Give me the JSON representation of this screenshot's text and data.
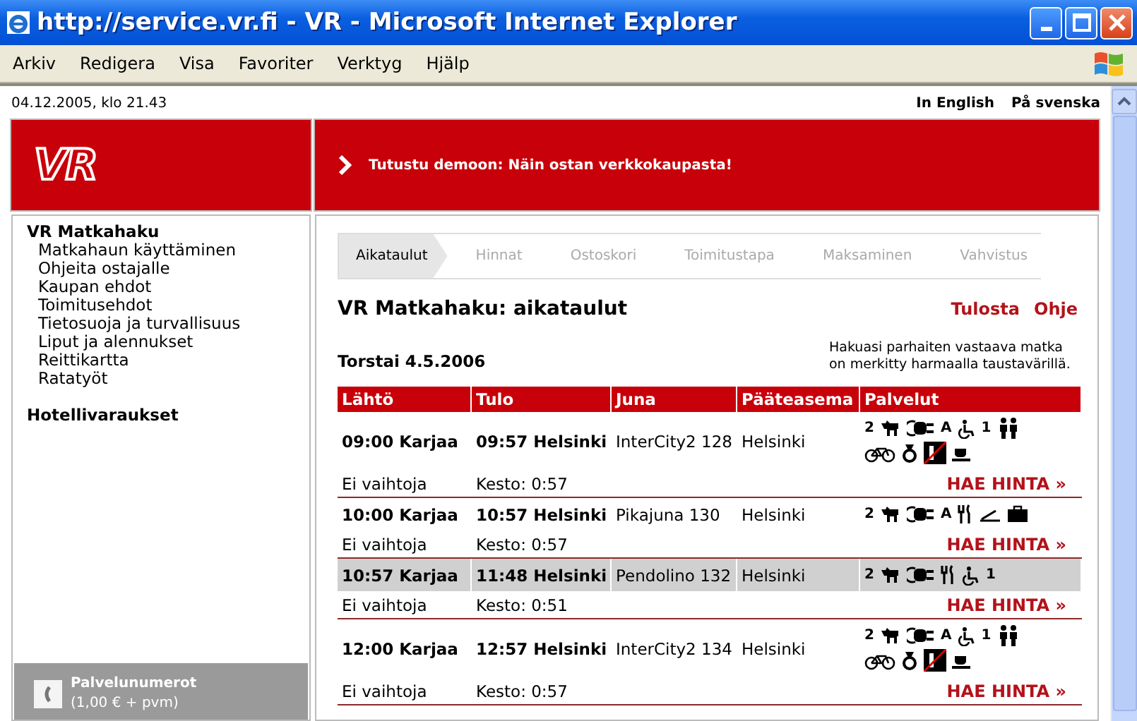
{
  "window": {
    "title": "http://service.vr.fi - VR - Microsoft Internet Explorer"
  },
  "menu": [
    "Arkiv",
    "Redigera",
    "Visa",
    "Favoriter",
    "Verktyg",
    "Hjälp"
  ],
  "page": {
    "date": "04.12.2005, klo 21.43",
    "languages": [
      "In English",
      "På svenska"
    ],
    "logo": "VR",
    "banner": "Tutustu demoon: Näin ostan verkkokaupasta!",
    "sidebar": {
      "sections": [
        {
          "title": "VR Matkahaku",
          "items": [
            "Matkahaun käyttäminen",
            "Ohjeita ostajalle",
            "Kaupan ehdot",
            "Toimitusehdot",
            "Tietosuoja ja turvallisuus",
            "Liput ja alennukset",
            "Reittikartta",
            "Ratatyöt"
          ]
        },
        {
          "title": "Hotellivaraukset"
        }
      ],
      "footer": {
        "title": "Palvelunumerot",
        "subtitle": "(1,00 € + pvm)"
      }
    },
    "steps": [
      {
        "label": "Aikataulut",
        "selected": true
      },
      {
        "label": "Hinnat",
        "selected": false
      },
      {
        "label": "Ostoskori",
        "selected": false
      },
      {
        "label": "Toimitustapa",
        "selected": false
      },
      {
        "label": "Maksaminen",
        "selected": false
      },
      {
        "label": "Vahvistus",
        "selected": false
      }
    ],
    "heading": "VR Matkahaku: aikataulut",
    "actions": [
      "Tulosta",
      "Ohje"
    ],
    "day": "Torstai 4.5.2006",
    "note": "Hakuasi parhaiten vastaava matka on merkitty harmaalla taustavärillä.",
    "table": {
      "columns": [
        "Lähtö",
        "Tulo",
        "Juna",
        "Pääteasema",
        "Palvelut"
      ],
      "rows": [
        {
          "departure": "09:00 Karjaa",
          "arrival": "09:57 Helsinki",
          "train": "InterCity2 128",
          "terminus": "Helsinki",
          "selected": false,
          "transfers": "Ei vaihtoja",
          "duration": "Kesto: 0:57",
          "price": "HAE HINTA »",
          "services": [
            [
              {
                "kind": "text",
                "text": "2"
              },
              {
                "kind": "dog"
              },
              {
                "kind": "plug"
              },
              {
                "kind": "text",
                "text": "A"
              },
              {
                "kind": "wheelchair"
              },
              {
                "kind": "text",
                "text": "1"
              },
              {
                "kind": "family"
              }
            ],
            [
              {
                "kind": "bike"
              },
              {
                "kind": "medal"
              },
              {
                "kind": "nosmoking"
              },
              {
                "kind": "cup"
              }
            ]
          ]
        },
        {
          "departure": "10:00 Karjaa",
          "arrival": "10:57 Helsinki",
          "train": "Pikajuna 130",
          "terminus": "Helsinki",
          "selected": false,
          "transfers": "Ei vaihtoja",
          "duration": "Kesto: 0:57",
          "price": "HAE HINTA »",
          "services": [
            [
              {
                "kind": "text",
                "text": "2"
              },
              {
                "kind": "dog"
              },
              {
                "kind": "plug"
              },
              {
                "kind": "text",
                "text": "A"
              },
              {
                "kind": "cutlery"
              },
              {
                "kind": "bed"
              },
              {
                "kind": "bag"
              }
            ]
          ]
        },
        {
          "departure": "10:57 Karjaa",
          "arrival": "11:48 Helsinki",
          "train": "Pendolino 132",
          "terminus": "Helsinki",
          "selected": true,
          "transfers": "Ei vaihtoja",
          "duration": "Kesto: 0:51",
          "price": "HAE HINTA »",
          "services": [
            [
              {
                "kind": "text",
                "text": "2"
              },
              {
                "kind": "dog"
              },
              {
                "kind": "plug"
              },
              {
                "kind": "cutlery"
              },
              {
                "kind": "wheelchair"
              },
              {
                "kind": "text",
                "text": "1"
              }
            ]
          ]
        },
        {
          "departure": "12:00 Karjaa",
          "arrival": "12:57 Helsinki",
          "train": "InterCity2 134",
          "terminus": "Helsinki",
          "selected": false,
          "transfers": "Ei vaihtoja",
          "duration": "Kesto: 0:57",
          "price": "HAE HINTA »",
          "services": [
            [
              {
                "kind": "text",
                "text": "2"
              },
              {
                "kind": "dog"
              },
              {
                "kind": "plug"
              },
              {
                "kind": "text",
                "text": "A"
              },
              {
                "kind": "wheelchair"
              },
              {
                "kind": "text",
                "text": "1"
              },
              {
                "kind": "family"
              }
            ],
            [
              {
                "kind": "bike"
              },
              {
                "kind": "medal"
              },
              {
                "kind": "nosmoking"
              },
              {
                "kind": "cup"
              }
            ]
          ]
        }
      ]
    }
  }
}
